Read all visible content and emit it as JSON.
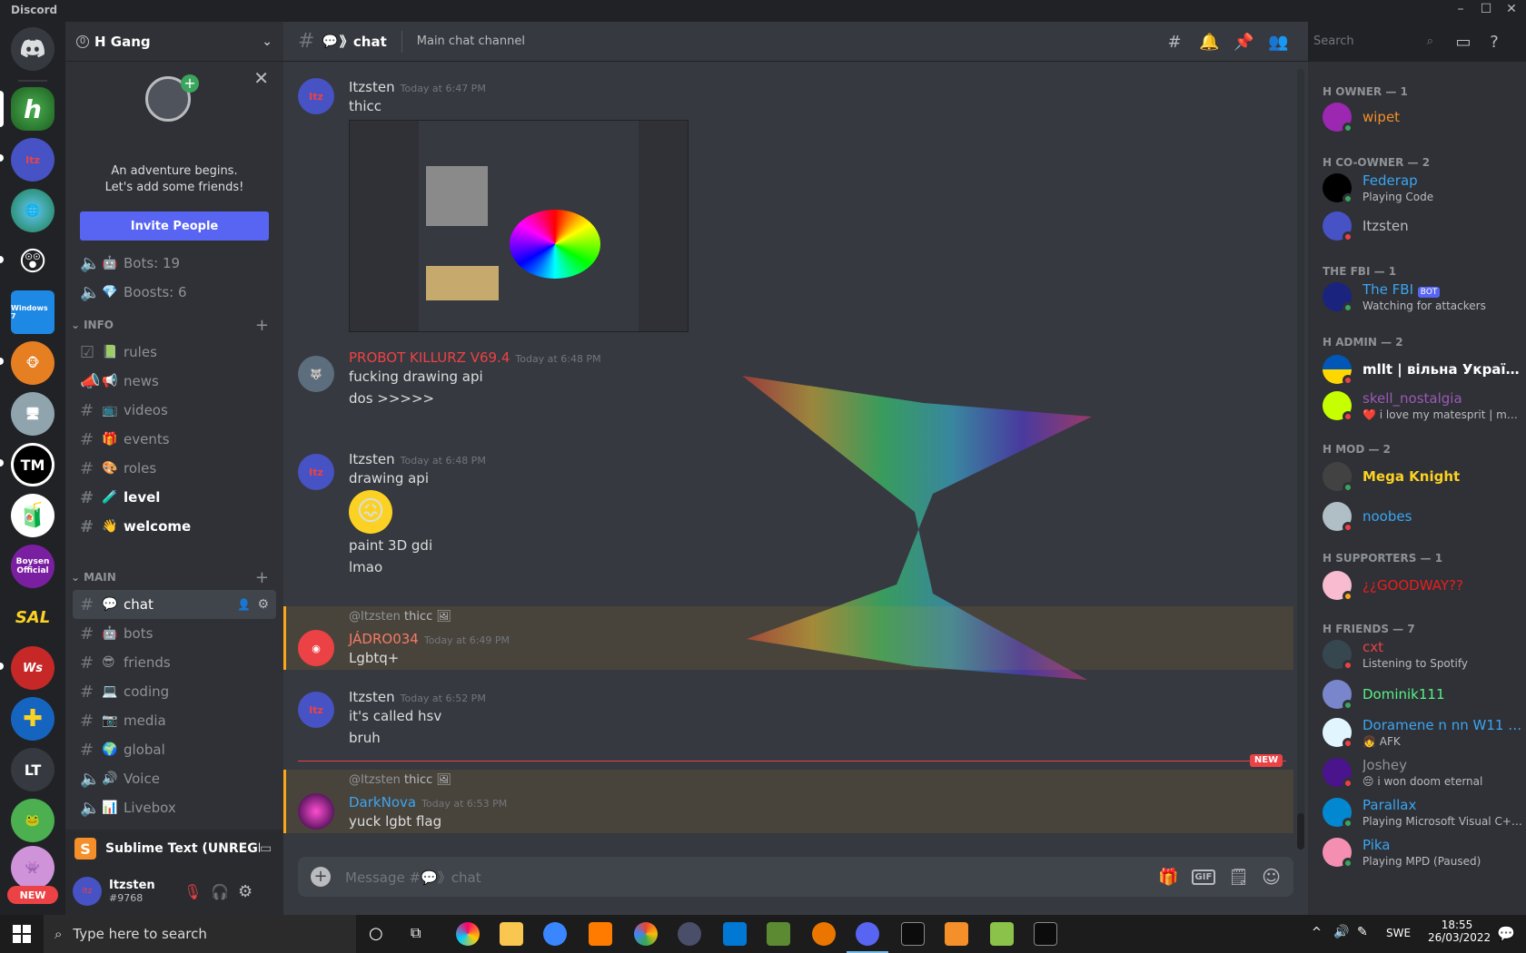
{
  "app": {
    "title": "Discord"
  },
  "server": {
    "name": "H Gang"
  },
  "invite": {
    "line1": "An adventure begins.",
    "line2": "Let's add some friends!",
    "button": "Invite People"
  },
  "stats": [
    {
      "label": "Bots: 19",
      "emoji": "🤖"
    },
    {
      "label": "Boosts: 6",
      "emoji": "💎"
    }
  ],
  "categories": {
    "info": "INFO",
    "main": "MAIN"
  },
  "info_channels": [
    {
      "name": "rules",
      "emoji": "📗",
      "type": "check"
    },
    {
      "name": "news",
      "emoji": "📢",
      "type": "announce"
    },
    {
      "name": "videos",
      "emoji": "📺",
      "type": "text"
    },
    {
      "name": "events",
      "emoji": "🎁",
      "type": "text"
    },
    {
      "name": "roles",
      "emoji": "🎨",
      "type": "text"
    },
    {
      "name": "level",
      "emoji": "🧪",
      "type": "text"
    },
    {
      "name": "welcome",
      "emoji": "👋",
      "type": "text"
    }
  ],
  "main_channels": [
    {
      "name": "chat",
      "emoji": "💬",
      "type": "text"
    },
    {
      "name": "bots",
      "emoji": "🤖",
      "type": "text"
    },
    {
      "name": "friends",
      "emoji": "😎",
      "type": "text"
    },
    {
      "name": "coding",
      "emoji": "💻",
      "type": "text"
    },
    {
      "name": "media",
      "emoji": "📷",
      "type": "text"
    },
    {
      "name": "global",
      "emoji": "🌍",
      "type": "text"
    },
    {
      "name": "Voice",
      "emoji": "🔊",
      "type": "voice"
    },
    {
      "name": "Livebox",
      "emoji": "📊",
      "type": "voice"
    }
  ],
  "activity": {
    "name": "Sublime Text (UNREGI..."
  },
  "user": {
    "name": "Itzsten",
    "tag": "#9768"
  },
  "guild_labels": {
    "tm": "TM",
    "lt": "LT",
    "new": "NEW",
    "sal": "SAL",
    "boysen": "Boysen Official",
    "win": "Windows 7"
  },
  "header": {
    "channel": "chat",
    "topic": "Main chat channel",
    "search_placeholder": "Search"
  },
  "messages": [
    {
      "author": "Itzsten",
      "time": "Today at 6:47 PM",
      "lines": [
        "thicc"
      ],
      "color": "#dcddde"
    },
    {
      "author": "PROBOT KILLURZ V69.4",
      "time": "Today at 6:48 PM",
      "lines": [
        "fucking drawing api",
        "dos >>>>>"
      ],
      "color": "#ed4245"
    },
    {
      "author": "Itzsten",
      "time": "Today at 6:48 PM",
      "lines": [
        "drawing api",
        "paint 3D gdi",
        "lmao"
      ],
      "color": "#dcddde"
    },
    {
      "author": "JÁDRO034",
      "time": "Today at 6:49 PM",
      "lines": [
        "Lgbtq+"
      ],
      "color": "#f47b67",
      "reply_to": "@Itzsten",
      "reply_text": "thicc"
    },
    {
      "author": "Itzsten",
      "time": "Today at 6:52 PM",
      "lines": [
        "it's called hsv",
        "bruh"
      ],
      "color": "#dcddde"
    },
    {
      "author": "DarkNova",
      "time": "Today at 6:53 PM",
      "lines": [
        "yuck lgbt flag"
      ],
      "color": "#3ba5f2",
      "reply_to": "@Itzsten",
      "reply_text": "thicc"
    }
  ],
  "new_badge": "NEW",
  "composer": {
    "placeholder": "Message #💬》chat",
    "gif": "GIF"
  },
  "members": {
    "categories": [
      "H OWNER — 1",
      "H CO-OWNER — 2",
      "THE FBI — 1",
      "H ADMIN — 2",
      "H MOD — 2",
      "H SUPPORTERS — 1",
      "H FRIENDS — 7"
    ],
    "list": [
      {
        "name": "wipet",
        "status": "",
        "color": "#f58f29"
      },
      {
        "name": "Federap",
        "status": "Playing Code",
        "color": "#3ba5f2"
      },
      {
        "name": "Itzsten",
        "status": "",
        "color": "#b9bbbe"
      },
      {
        "name": "The FBI",
        "status": "Watching for attackers",
        "color": "#3ba5f2",
        "bot": "BOT"
      },
      {
        "name": "mllt | вільна Україна!",
        "status": "",
        "color": "#ffffff"
      },
      {
        "name": "skell_nostalgia",
        "status": "❤️ i love my matesprit | my m...",
        "color": "#9b59b6"
      },
      {
        "name": "Mega Knight",
        "status": "",
        "color": "#fbd224"
      },
      {
        "name": "noobes",
        "status": "",
        "color": "#3ba5f2"
      },
      {
        "name": "¿¿GOODWAY??",
        "status": "",
        "color": "#e91e1e"
      },
      {
        "name": "cxt",
        "status": "Listening to Spotify",
        "color": "#ed4245"
      },
      {
        "name": "Dominik111",
        "status": "",
        "color": "#57f287"
      },
      {
        "name": "Doramene n nn W11 U...",
        "status": "👧 AFK",
        "color": "#3ba5f2"
      },
      {
        "name": "Joshey",
        "status": "😔 i won doom eternal",
        "color": "#8e9297"
      },
      {
        "name": "Parallax",
        "status": "Playing Microsoft Visual C++ ...",
        "color": "#3ba5f2"
      },
      {
        "name": "Pika",
        "status": "Playing MPD (Paused)",
        "color": "#3ba5f2"
      }
    ]
  },
  "taskbar": {
    "search": "Type here to search",
    "lang": "SWE",
    "time": "18:55",
    "date": "26/03/2022"
  },
  "colors": {
    "blurple": "#5865f2",
    "online": "#3ba55d",
    "dnd": "#ed4245",
    "idle": "#faa81a"
  }
}
